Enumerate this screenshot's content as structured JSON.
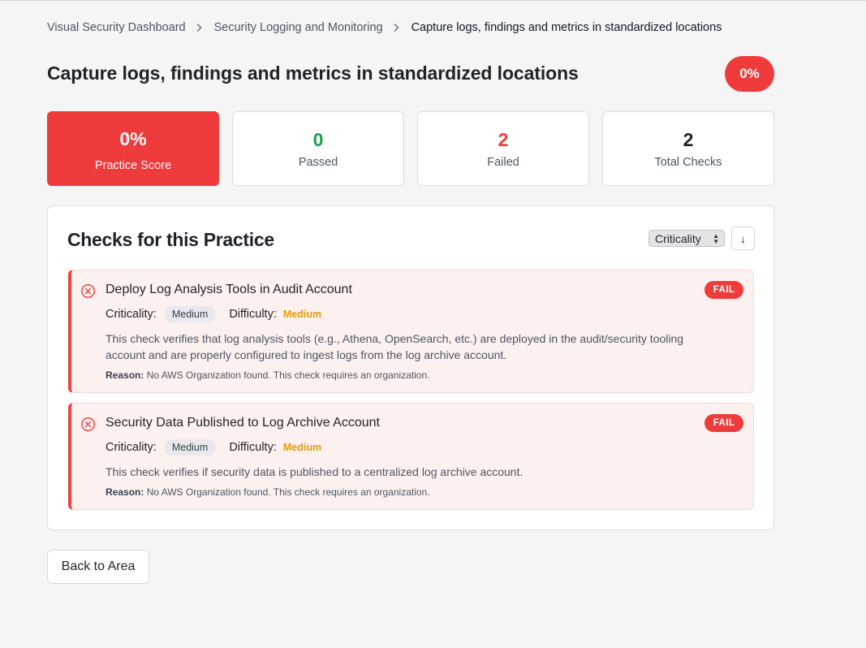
{
  "breadcrumb": {
    "items": [
      "Visual Security Dashboard",
      "Security Logging and Monitoring"
    ],
    "current": "Capture logs, findings and metrics in standardized locations"
  },
  "page": {
    "title": "Capture logs, findings and metrics in standardized locations",
    "score_pill": "0%"
  },
  "stats": {
    "score": {
      "value": "0%",
      "label": "Practice Score"
    },
    "passed": {
      "value": "0",
      "label": "Passed"
    },
    "failed": {
      "value": "2",
      "label": "Failed"
    },
    "total": {
      "value": "2",
      "label": "Total Checks"
    }
  },
  "checks_section": {
    "title": "Checks for this Practice",
    "sort_select": "Criticality",
    "sort_direction_icon": "arrow-down-icon",
    "items": [
      {
        "name": "Deploy Log Analysis Tools in Audit Account",
        "status": "FAIL",
        "criticality_label": "Criticality:",
        "criticality": "Medium",
        "difficulty_label": "Difficulty:",
        "difficulty": "Medium",
        "description": "This check verifies that log analysis tools (e.g., Athena, OpenSearch, etc.) are deployed in the audit/security tooling account and are properly configured to ingest logs from the log archive account.",
        "reason_label": "Reason:",
        "reason": "No AWS Organization found. This check requires an organization."
      },
      {
        "name": "Security Data Published to Log Archive Account",
        "status": "FAIL",
        "criticality_label": "Criticality:",
        "criticality": "Medium",
        "difficulty_label": "Difficulty:",
        "difficulty": "Medium",
        "description": "This check verifies if security data is published to a centralized log archive account.",
        "reason_label": "Reason:",
        "reason": "No AWS Organization found. This check requires an organization."
      }
    ]
  },
  "back_button": "Back to Area",
  "colors": {
    "fail_red": "#ef3b3b",
    "pass_green": "#16a34a",
    "difficulty_orange": "#e59a0c"
  }
}
